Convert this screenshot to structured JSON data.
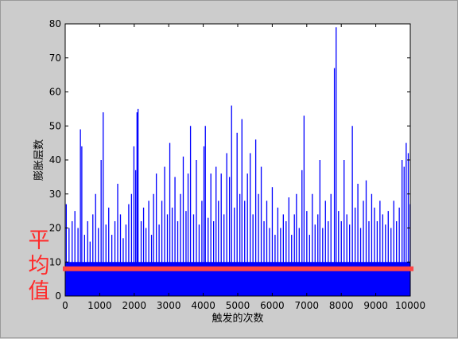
{
  "chart_data": {
    "type": "bar",
    "xlabel": "触发的次数",
    "ylabel": "膨胀层数",
    "xlim": [
      0,
      10000
    ],
    "ylim": [
      0,
      80
    ],
    "xticks": [
      0,
      1000,
      2000,
      3000,
      4000,
      5000,
      6000,
      7000,
      8000,
      9000,
      10000
    ],
    "yticks": [
      0,
      10,
      20,
      30,
      40,
      50,
      60,
      70,
      80
    ],
    "grid": false,
    "series": [
      {
        "color": "#0000ff",
        "baseline": 10,
        "peaks": [
          {
            "x": 30,
            "y": 27
          },
          {
            "x": 110,
            "y": 20
          },
          {
            "x": 200,
            "y": 22
          },
          {
            "x": 280,
            "y": 25
          },
          {
            "x": 370,
            "y": 20
          },
          {
            "x": 440,
            "y": 49
          },
          {
            "x": 480,
            "y": 44
          },
          {
            "x": 560,
            "y": 18
          },
          {
            "x": 650,
            "y": 22
          },
          {
            "x": 720,
            "y": 16
          },
          {
            "x": 800,
            "y": 24
          },
          {
            "x": 880,
            "y": 30
          },
          {
            "x": 960,
            "y": 20
          },
          {
            "x": 1040,
            "y": 40
          },
          {
            "x": 1100,
            "y": 54
          },
          {
            "x": 1180,
            "y": 21
          },
          {
            "x": 1260,
            "y": 26
          },
          {
            "x": 1350,
            "y": 18
          },
          {
            "x": 1440,
            "y": 22
          },
          {
            "x": 1520,
            "y": 33
          },
          {
            "x": 1600,
            "y": 24
          },
          {
            "x": 1680,
            "y": 17
          },
          {
            "x": 1760,
            "y": 21
          },
          {
            "x": 1840,
            "y": 27
          },
          {
            "x": 1920,
            "y": 30
          },
          {
            "x": 1990,
            "y": 44
          },
          {
            "x": 2040,
            "y": 37
          },
          {
            "x": 2080,
            "y": 54
          },
          {
            "x": 2110,
            "y": 55
          },
          {
            "x": 2200,
            "y": 22
          },
          {
            "x": 2270,
            "y": 26
          },
          {
            "x": 2340,
            "y": 20
          },
          {
            "x": 2420,
            "y": 28
          },
          {
            "x": 2500,
            "y": 18
          },
          {
            "x": 2560,
            "y": 30
          },
          {
            "x": 2640,
            "y": 36
          },
          {
            "x": 2720,
            "y": 21
          },
          {
            "x": 2800,
            "y": 28
          },
          {
            "x": 2880,
            "y": 38
          },
          {
            "x": 2960,
            "y": 24
          },
          {
            "x": 3030,
            "y": 45
          },
          {
            "x": 3100,
            "y": 26
          },
          {
            "x": 3180,
            "y": 35
          },
          {
            "x": 3260,
            "y": 22
          },
          {
            "x": 3340,
            "y": 30
          },
          {
            "x": 3420,
            "y": 41
          },
          {
            "x": 3500,
            "y": 25
          },
          {
            "x": 3560,
            "y": 36
          },
          {
            "x": 3630,
            "y": 50
          },
          {
            "x": 3720,
            "y": 24
          },
          {
            "x": 3800,
            "y": 40
          },
          {
            "x": 3880,
            "y": 21
          },
          {
            "x": 3960,
            "y": 28
          },
          {
            "x": 4020,
            "y": 44
          },
          {
            "x": 4060,
            "y": 50
          },
          {
            "x": 4140,
            "y": 23
          },
          {
            "x": 4220,
            "y": 36
          },
          {
            "x": 4300,
            "y": 22
          },
          {
            "x": 4370,
            "y": 38
          },
          {
            "x": 4440,
            "y": 28
          },
          {
            "x": 4520,
            "y": 36
          },
          {
            "x": 4600,
            "y": 24
          },
          {
            "x": 4680,
            "y": 42
          },
          {
            "x": 4760,
            "y": 35
          },
          {
            "x": 4820,
            "y": 56
          },
          {
            "x": 4900,
            "y": 26
          },
          {
            "x": 4980,
            "y": 48
          },
          {
            "x": 5060,
            "y": 30
          },
          {
            "x": 5120,
            "y": 52
          },
          {
            "x": 5200,
            "y": 28
          },
          {
            "x": 5280,
            "y": 36
          },
          {
            "x": 5360,
            "y": 42
          },
          {
            "x": 5440,
            "y": 24
          },
          {
            "x": 5520,
            "y": 46
          },
          {
            "x": 5600,
            "y": 30
          },
          {
            "x": 5680,
            "y": 38
          },
          {
            "x": 5760,
            "y": 22
          },
          {
            "x": 5840,
            "y": 28
          },
          {
            "x": 5920,
            "y": 20
          },
          {
            "x": 6000,
            "y": 32
          },
          {
            "x": 6080,
            "y": 18
          },
          {
            "x": 6160,
            "y": 26
          },
          {
            "x": 6240,
            "y": 20
          },
          {
            "x": 6320,
            "y": 24
          },
          {
            "x": 6400,
            "y": 22
          },
          {
            "x": 6480,
            "y": 29
          },
          {
            "x": 6560,
            "y": 18
          },
          {
            "x": 6640,
            "y": 24
          },
          {
            "x": 6700,
            "y": 30
          },
          {
            "x": 6780,
            "y": 20
          },
          {
            "x": 6860,
            "y": 37
          },
          {
            "x": 6920,
            "y": 53
          },
          {
            "x": 7000,
            "y": 25
          },
          {
            "x": 7080,
            "y": 18
          },
          {
            "x": 7160,
            "y": 30
          },
          {
            "x": 7240,
            "y": 21
          },
          {
            "x": 7320,
            "y": 24
          },
          {
            "x": 7380,
            "y": 40
          },
          {
            "x": 7460,
            "y": 20
          },
          {
            "x": 7540,
            "y": 28
          },
          {
            "x": 7620,
            "y": 22
          },
          {
            "x": 7700,
            "y": 30
          },
          {
            "x": 7800,
            "y": 67
          },
          {
            "x": 7850,
            "y": 79
          },
          {
            "x": 7920,
            "y": 25
          },
          {
            "x": 8000,
            "y": 22
          },
          {
            "x": 8080,
            "y": 40
          },
          {
            "x": 8160,
            "y": 24
          },
          {
            "x": 8240,
            "y": 21
          },
          {
            "x": 8320,
            "y": 50
          },
          {
            "x": 8400,
            "y": 26
          },
          {
            "x": 8480,
            "y": 33
          },
          {
            "x": 8560,
            "y": 20
          },
          {
            "x": 8640,
            "y": 28
          },
          {
            "x": 8720,
            "y": 34
          },
          {
            "x": 8800,
            "y": 22
          },
          {
            "x": 8880,
            "y": 30
          },
          {
            "x": 8960,
            "y": 26
          },
          {
            "x": 9040,
            "y": 22
          },
          {
            "x": 9120,
            "y": 28
          },
          {
            "x": 9200,
            "y": 24
          },
          {
            "x": 9280,
            "y": 21
          },
          {
            "x": 9360,
            "y": 25
          },
          {
            "x": 9440,
            "y": 20
          },
          {
            "x": 9520,
            "y": 28
          },
          {
            "x": 9600,
            "y": 22
          },
          {
            "x": 9680,
            "y": 26
          },
          {
            "x": 9760,
            "y": 40
          },
          {
            "x": 9820,
            "y": 38
          },
          {
            "x": 9880,
            "y": 45
          },
          {
            "x": 9940,
            "y": 42
          },
          {
            "x": 9990,
            "y": 27
          }
        ]
      }
    ],
    "mean_line": {
      "y": 8,
      "color": "#ff4545",
      "label": "平\n均\n值"
    }
  }
}
